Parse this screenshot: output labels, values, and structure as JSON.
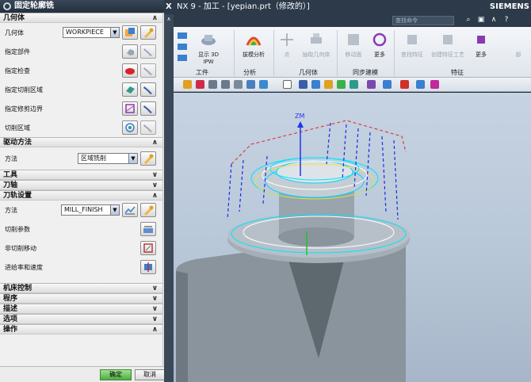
{
  "dialog": {
    "title": "固定轮廓铣",
    "sections": {
      "geometry": {
        "title": "几何体",
        "geometry_label": "几何体",
        "geometry_value": "WORKPIECE",
        "specify_part": "指定部件",
        "specify_check": "指定检查",
        "specify_cut_area": "指定切削区域",
        "specify_trim": "指定修剪边界",
        "cut_region": "切削区域"
      },
      "drive": {
        "title": "驱动方法",
        "method_label": "方法",
        "method_value": "区域铣削"
      },
      "tool": {
        "title": "工具"
      },
      "axis": {
        "title": "刀轴"
      },
      "path": {
        "title": "刀轨设置",
        "method_label": "方法",
        "method_value": "MILL_FINISH",
        "cut_params": "切削参数",
        "non_cut": "非切削移动",
        "feeds": "进给率和速度"
      },
      "machine": {
        "title": "机床控制"
      },
      "program": {
        "title": "程序"
      },
      "description": {
        "title": "描述"
      },
      "options": {
        "title": "选项"
      },
      "actions": {
        "title": "操作"
      }
    },
    "ok": "确定",
    "cancel": "取消"
  },
  "app": {
    "title": "NX 9 - 加工 - [yepian.prt（修改的）]",
    "brand": "SIEMENS",
    "search_placeholder": "查找命令",
    "ribbon": {
      "display3d": "显示 3D IPW",
      "shape_analysis": "拔模分析",
      "point": "点",
      "extract_body": "抽取几何体",
      "move_face": "移动面",
      "more1": "更多",
      "find_feature": "查找特征",
      "create_feature_process": "创建特征工艺",
      "more2": "更多",
      "part": "部",
      "groups": {
        "workpiece": "工件",
        "analysis": "分析",
        "geometry": "几何体",
        "sync": "同步建模",
        "feature": "特征"
      }
    },
    "viewport": {
      "axis_label": "ZM"
    }
  }
}
